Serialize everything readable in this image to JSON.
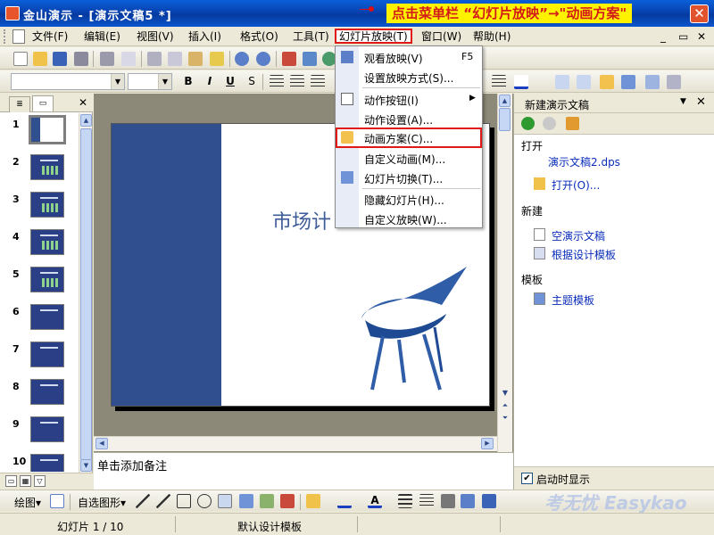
{
  "window": {
    "title": "金山演示 - [演示文稿5 *]",
    "callout": "点击菜单栏 “幻灯片放映”→\"动画方案\"",
    "close_glyph": "✕"
  },
  "menubar": {
    "items": [
      "文件(F)",
      "编辑(E)",
      "视图(V)",
      "插入(I)",
      "格式(O)",
      "工具(T)",
      "幻灯片放映(T)",
      "窗口(W)",
      "帮助(H)"
    ],
    "controls": [
      "_",
      "▭",
      "✕"
    ]
  },
  "format_toolbar": {
    "bold": "B",
    "italic": "I",
    "underline": "U",
    "shadow": "S"
  },
  "left_pane": {
    "close": "✕",
    "tabs": [
      "outline",
      "slides"
    ],
    "slides": [
      "1",
      "2",
      "3",
      "4",
      "5",
      "6",
      "7",
      "8",
      "9",
      "10"
    ]
  },
  "slide": {
    "title": "市场计"
  },
  "notes_placeholder": "单击添加备注",
  "dropdown": {
    "items": [
      {
        "label": "观看放映(V)",
        "shortcut": "F5"
      },
      {
        "label": "设置放映方式(S)..."
      },
      {
        "label": "动作按钮(I)",
        "submenu": "▶"
      },
      {
        "label": "动作设置(A)..."
      },
      {
        "label": "动画方案(C)..."
      },
      {
        "label": "自定义动画(M)..."
      },
      {
        "label": "幻灯片切换(T)..."
      },
      {
        "label": "隐藏幻灯片(H)..."
      },
      {
        "label": "自定义放映(W)..."
      }
    ]
  },
  "task_pane": {
    "title": "新建演示文稿",
    "sections": {
      "open": "打开",
      "recent_file": "演示文稿2.dps",
      "open_link": "打开(O)...",
      "new": "新建",
      "blank": "空演示文稿",
      "from_template": "根据设计模板",
      "templates": "模板",
      "theme_templates": "主题模板"
    },
    "startup_label": "启动时显示",
    "startup_checked": "✔"
  },
  "drawbar": {
    "draw": "绘图▾",
    "autoshapes": "自选图形▾"
  },
  "statusbar": {
    "slide": "幻灯片 1 / 10",
    "design": "默认设计模板"
  },
  "watermark": "考无忧 Easykao",
  "colors": {
    "title_blue": "#0a4fd0",
    "highlight_red": "#e01818",
    "callout_yellow": "#fff200",
    "slide_blue": "#2f4f8f"
  }
}
